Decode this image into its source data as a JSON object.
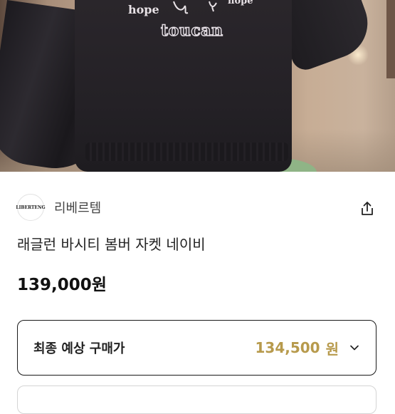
{
  "photo": {
    "print_left": "hope",
    "print_right": "hope",
    "print_main": "toucan"
  },
  "shop": {
    "logo_text": "LIBERTENG",
    "name": "리베르템"
  },
  "product": {
    "title": "래글런 바시티 봄버 자켓 네이비",
    "price": "139,000원"
  },
  "final_price": {
    "label": "최종 예상 구매가",
    "amount": "134,500",
    "currency": "원"
  },
  "icons": {
    "share": "share-icon",
    "expand": "chevron-down-icon"
  },
  "colors": {
    "accent_price": "#b79a4c",
    "text": "#1a1a1a"
  }
}
